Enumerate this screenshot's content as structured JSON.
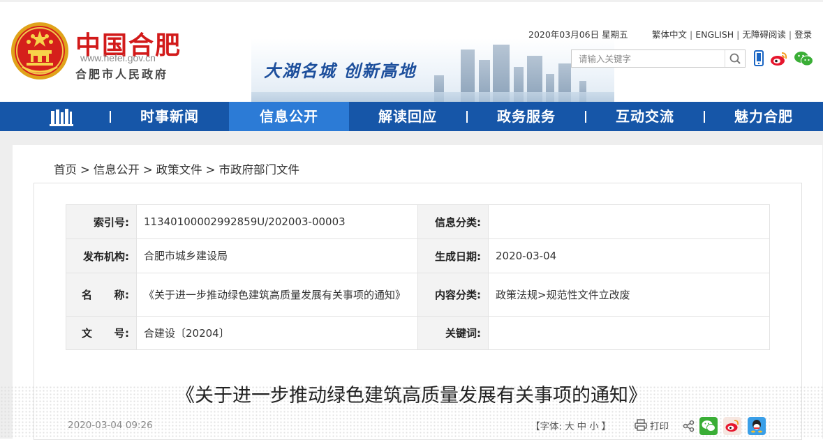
{
  "header": {
    "logo_title": "中国合肥",
    "logo_url": "www.hefei.gov.cn",
    "logo_subtitle": "合肥市人民政府",
    "slogan": "大湖名城  创新高地",
    "date": "2020年03月06日  星期五",
    "links": [
      "繁体中文",
      "ENGLISH",
      "无障碍阅读",
      "登录"
    ],
    "search_placeholder": "请输入关键字",
    "social_icons": [
      "mobile-icon",
      "weibo-icon",
      "wechat-icon"
    ],
    "colors": {
      "logo_red": "#d21a1a",
      "slogan_blue": "#1d4f9c"
    }
  },
  "nav": {
    "items": [
      "时事新闻",
      "信息公开",
      "解读回应",
      "政务服务",
      "互动交流",
      "魅力合肥"
    ],
    "active_index": 1,
    "colors": {
      "bar": "#1656a8",
      "active": "#2c7bd6"
    }
  },
  "breadcrumb": [
    "首页",
    "信息公开",
    "政策文件",
    "市政府部门文件"
  ],
  "meta": {
    "index_label": "索引号:",
    "index_value": "11340100002992859U/202003-00003",
    "category_label": "信息分类:",
    "category_value": "",
    "publisher_label": "发布机构:",
    "publisher_value": "合肥市城乡建设局",
    "created_label": "生成日期:",
    "created_value": "2020-03-04",
    "name_label": "名　　称:",
    "name_value": "《关于进一步推动绿色建筑高质量发展有关事项的通知》",
    "content_type_label": "内容分类:",
    "content_type_value": "政策法规>规范性文件立改废",
    "doc_no_label": "文　　号:",
    "doc_no_value": "合建设〔20204〕",
    "keywords_label": "关键词:",
    "keywords_value": ""
  },
  "article": {
    "title": "《关于进一步推动绿色建筑高质量发展有关事项的通知》",
    "publish_time": "2020-03-04 09:26",
    "font_size_prefix": "【字体:",
    "font_large": "大",
    "font_medium": "中",
    "font_small": "小",
    "font_size_suffix": "】",
    "print_label": "打印"
  }
}
